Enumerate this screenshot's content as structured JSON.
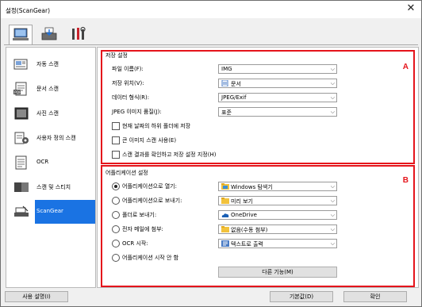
{
  "window": {
    "title": "설정(ScanGear)"
  },
  "toolbar_tabs": [
    {
      "icon": "scan-computer-icon"
    },
    {
      "icon": "scan-device-icon"
    },
    {
      "icon": "tools-icon"
    }
  ],
  "sidebar": {
    "items": [
      {
        "label": "자동 스캔",
        "icon": "auto-scan-icon"
      },
      {
        "label": "문서 스캔",
        "icon": "document-scan-icon"
      },
      {
        "label": "사진 스캔",
        "icon": "photo-scan-icon"
      },
      {
        "label": "사용자 정의 스캔",
        "icon": "custom-scan-icon"
      },
      {
        "label": "OCR",
        "icon": "ocr-icon"
      },
      {
        "label": "스캔 및 스티치",
        "icon": "scan-stitch-icon"
      },
      {
        "label": "ScanGear",
        "icon": "scangear-icon"
      }
    ],
    "selected": "ScanGear"
  },
  "save_settings": {
    "heading": "저장 설정",
    "marker": "A",
    "file_name": {
      "label": "파일 이름(F):",
      "value": "IMG"
    },
    "save_in": {
      "label": "저장 위치(V):",
      "value": "문서"
    },
    "data_format": {
      "label": "데이터 형식(R):",
      "value": "JPEG/Exif"
    },
    "jpeg_quality": {
      "label": "JPEG 이미지 품질(J):",
      "value": "표준"
    },
    "checkboxes": [
      {
        "label": "현재 날짜의 하위 폴더에 저장",
        "checked": false
      },
      {
        "label": "큰 이미지 스캔 사용(E)",
        "checked": false
      },
      {
        "label": "스캔 결과를 확인하고 저장 설정 지정(H)",
        "checked": false
      }
    ]
  },
  "app_settings": {
    "heading": "어플리케이션 설정",
    "marker": "B",
    "options": [
      {
        "label": "어플리케이션으로 열기:",
        "value": "Windows 탐색기",
        "selected": true,
        "icon": "explorer-icon"
      },
      {
        "label": "어플리케이션으로 보내기:",
        "value": "미리 보기",
        "selected": false,
        "icon": "folder-icon"
      },
      {
        "label": "폴더로 보내기:",
        "value": "OneDrive",
        "selected": false,
        "icon": "onedrive-icon"
      },
      {
        "label": "전자 메일에 첨부:",
        "value": "없음(수동 첨부)",
        "selected": false,
        "icon": "mail-icon"
      },
      {
        "label": "OCR 시작:",
        "value": "텍스트로 출력",
        "selected": false,
        "icon": "text-icon"
      },
      {
        "label": "어플리케이션 시작 안 함",
        "value": "",
        "selected": false,
        "icon": ""
      }
    ],
    "more_button": "다른 기능(M)"
  },
  "footer": {
    "instructions": "사용 설명(I)",
    "defaults": "기본값(D)",
    "ok": "확인"
  },
  "colors": {
    "marker": "#e5141b",
    "selection": "#1a73e3"
  }
}
